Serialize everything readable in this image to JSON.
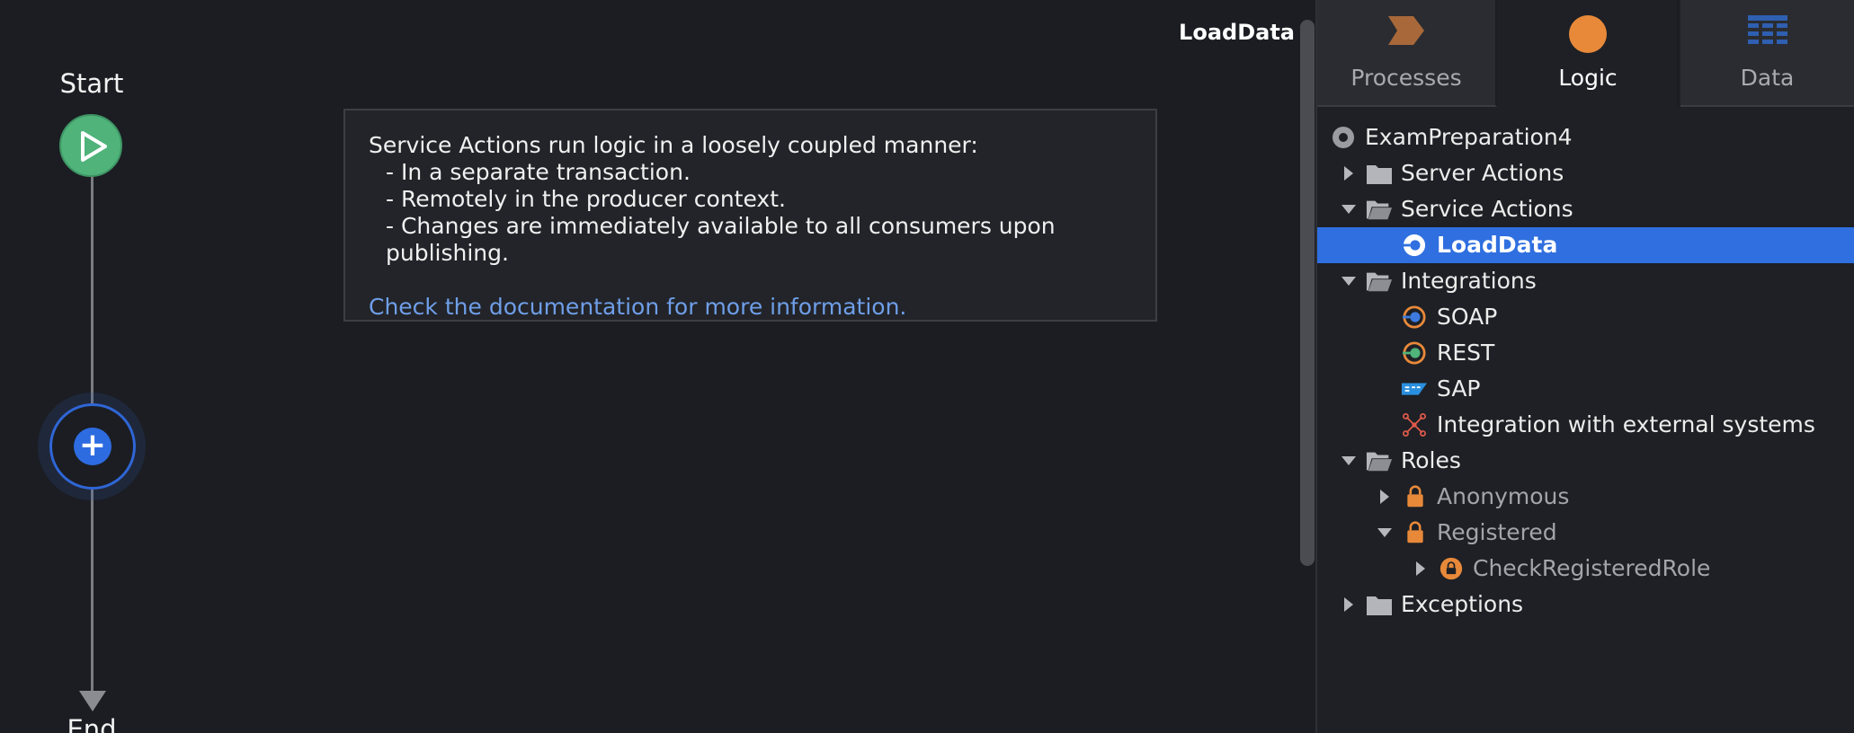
{
  "flow": {
    "start_label": "Start",
    "end_label": "End",
    "action_name": "LoadData"
  },
  "info": {
    "heading": "Service Actions run logic in a loosely coupled manner:",
    "bullets": [
      "- In a separate transaction.",
      "- Remotely in the producer context.",
      "- Changes are immediately available to all consumers upon publishing."
    ],
    "link": "Check the documentation for more information."
  },
  "tabs": [
    {
      "label": "Processes",
      "icon": "process-chevron-icon",
      "active": false
    },
    {
      "label": "Logic",
      "icon": "logic-circle-icon",
      "active": true
    },
    {
      "label": "Data",
      "icon": "data-grid-icon",
      "active": false
    }
  ],
  "tree": [
    {
      "label": "ExamPreparation4",
      "icon": "module-icon"
    },
    {
      "label": "Server Actions",
      "icon": "folder-icon",
      "expanded": false
    },
    {
      "label": "Service Actions",
      "icon": "folder-open-icon",
      "expanded": true
    },
    {
      "label": "LoadData",
      "icon": "service-action-icon",
      "selected": true
    },
    {
      "label": "Integrations",
      "icon": "folder-open-icon",
      "expanded": true
    },
    {
      "label": "SOAP",
      "icon": "soap-icon"
    },
    {
      "label": "REST",
      "icon": "rest-icon"
    },
    {
      "label": "SAP",
      "icon": "sap-icon"
    },
    {
      "label": "Integration with external systems",
      "icon": "external-integration-icon"
    },
    {
      "label": "Roles",
      "icon": "folder-open-icon",
      "expanded": true
    },
    {
      "label": "Anonymous",
      "icon": "lock-icon",
      "expanded": false
    },
    {
      "label": "Registered",
      "icon": "lock-icon",
      "expanded": true
    },
    {
      "label": "CheckRegisteredRole",
      "icon": "role-action-icon",
      "expanded": false
    },
    {
      "label": "Exceptions",
      "icon": "folder-icon",
      "expanded": false
    }
  ],
  "colors": {
    "accent": "#2f6fe0",
    "start_node": "#4fb37a",
    "orange": "#e8893a",
    "link": "#6f9ee8"
  }
}
